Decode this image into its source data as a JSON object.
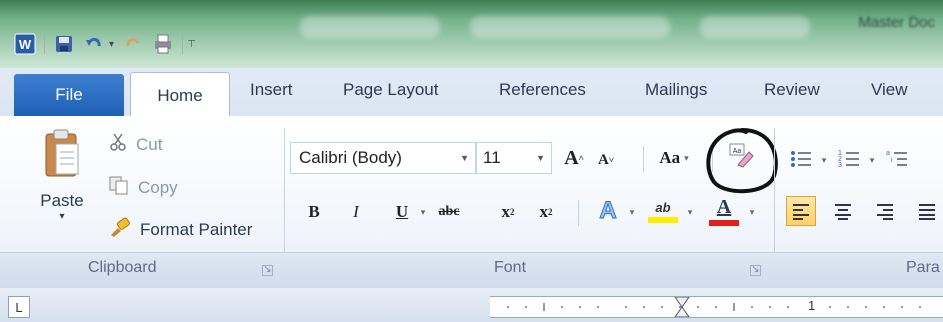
{
  "window": {
    "title": "Master Doc"
  },
  "quick_access": {
    "icons": [
      "word-logo-icon",
      "save-icon",
      "undo-icon",
      "redo-icon",
      "print-icon",
      "customize-icon"
    ]
  },
  "tabs": {
    "file": "File",
    "home": "Home",
    "items": [
      "Insert",
      "Page Layout",
      "References",
      "Mailings",
      "Review",
      "View"
    ]
  },
  "clipboard": {
    "paste_label": "Paste",
    "cut_label": "Cut",
    "copy_label": "Copy",
    "format_painter_label": "Format Painter",
    "group_label": "Clipboard"
  },
  "font": {
    "font_name": "Calibri (Body)",
    "font_size": "11",
    "change_case_label": "Aa",
    "bold_label": "B",
    "italic_label": "I",
    "underline_label": "U",
    "strikethrough_label": "abc",
    "subscript_label": "x",
    "superscript_label": "x",
    "text_effects_label": "A",
    "highlight_label": "ab",
    "font_color_label": "A",
    "group_label": "Font"
  },
  "paragraph": {
    "group_label": "Para"
  },
  "ruler": {
    "marker_label": "1"
  },
  "colors": {
    "accent": "#1f5fb5",
    "highlight": "#ffee00",
    "font_color": "#e0201b"
  }
}
